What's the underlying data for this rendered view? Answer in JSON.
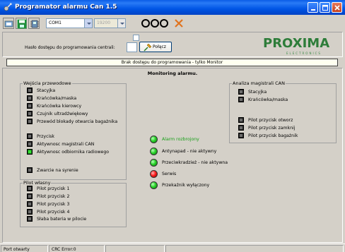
{
  "window": {
    "title": "Programator alarmu Can 1.5"
  },
  "toolbar": {
    "port_value": "COM1",
    "baud_value": "19200"
  },
  "access": {
    "password_label": "Hasło dostępu do programowania centrali:",
    "password_value": "",
    "connect_label": "Połącz"
  },
  "brand": {
    "logo_text": "PROXIMA",
    "logo_sub": "ELECTRONICS",
    "logo_color": "#2e7d3a"
  },
  "banner_text": "Brak dostępu do programowania - tylko Monitor",
  "main": {
    "title": "Monitoring alarmu."
  },
  "inputs_group": {
    "title": "Wejścia przewodowe",
    "items": [
      {
        "label": "Stacyjka",
        "on": false
      },
      {
        "label": "Krańcówka/maska",
        "on": false
      },
      {
        "label": "Krańcówka kierowcy",
        "on": false
      },
      {
        "label": "Czujnik ultradźwiękowy",
        "on": false
      },
      {
        "label": "Przewód blokady otwarcia bagażnika",
        "on": false
      },
      {
        "label": "Przycisk",
        "on": false
      },
      {
        "label": "Aktywnosc magistrali CAN",
        "on": false
      },
      {
        "label": "Aktywnosc odbiornika radiowego",
        "on": true
      },
      {
        "label": "Zwarcie na syrenie",
        "on": false
      }
    ]
  },
  "remote_group": {
    "title": "Pilot własny",
    "items": [
      {
        "label": "Pilot przycisk 1",
        "on": false
      },
      {
        "label": "Pilot przycisk 2",
        "on": false
      },
      {
        "label": "Pilot przycisk 3",
        "on": false
      },
      {
        "label": "Pilot przycisk 4",
        "on": false
      },
      {
        "label": "Słaba bateria w pilocie",
        "on": false
      }
    ]
  },
  "statuses": [
    {
      "label": "Alarm rozbrojony",
      "color": "green",
      "highlight": true
    },
    {
      "label": "Antynapad - nie aktywny",
      "color": "green",
      "highlight": false
    },
    {
      "label": "Przeciwkradzież - nie aktywna",
      "color": "green",
      "highlight": false
    },
    {
      "label": "Serwis",
      "color": "red",
      "highlight": false
    },
    {
      "label": "Przekaźnik wyłączony",
      "color": "green",
      "highlight": false
    }
  ],
  "can_group": {
    "title": "Analiza magistrali CAN",
    "items": [
      {
        "label": "Stacyjka",
        "on": false
      },
      {
        "label": "Krańcówka/maska",
        "on": false
      },
      {
        "label": "Pilot przycisk otworz",
        "on": false
      },
      {
        "label": "Pilot przycisk zamknij",
        "on": false
      },
      {
        "label": "Pilot przycisk bagażnik",
        "on": false
      }
    ]
  },
  "statusbar": {
    "port_state": "Port otwarty",
    "crc_error": "CRC Error:0"
  }
}
